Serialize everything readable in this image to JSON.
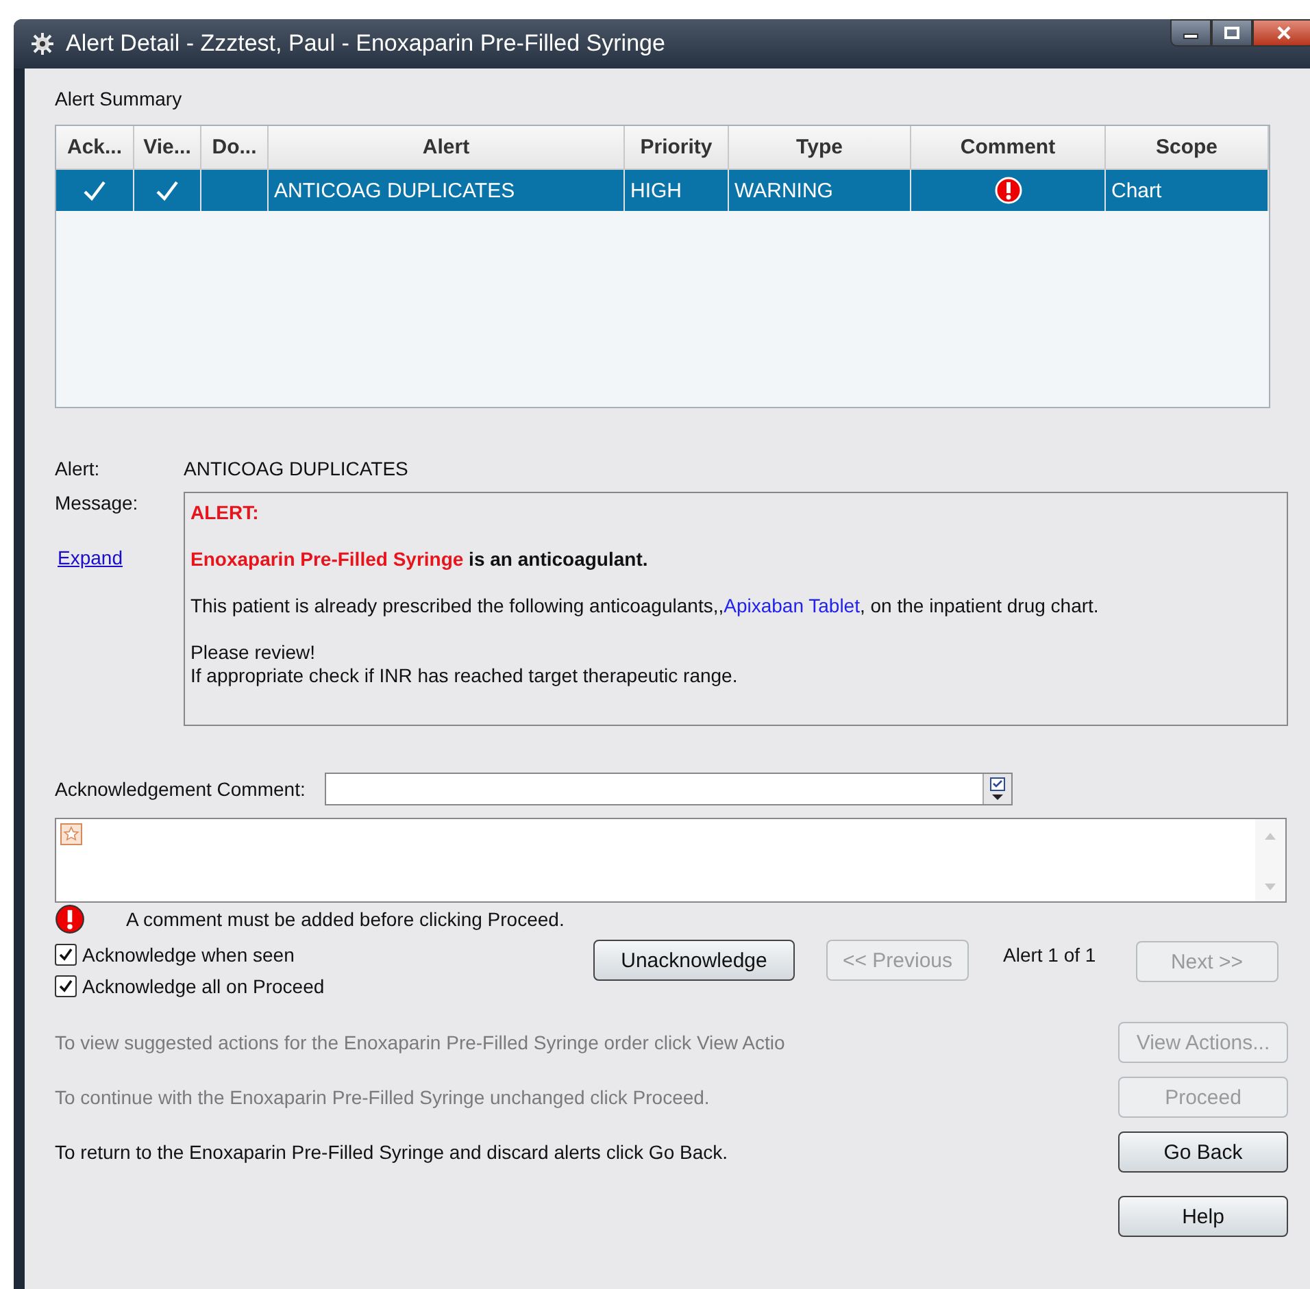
{
  "window": {
    "title": "Alert Detail - Zzztest, Paul - Enoxaparin Pre-Filled Syringe"
  },
  "summary": {
    "label": "Alert Summary",
    "columns": [
      {
        "label": "Ack...",
        "kind": "check"
      },
      {
        "label": "Vie...",
        "kind": "check"
      },
      {
        "label": "Do...",
        "kind": "check"
      },
      {
        "label": "Alert",
        "kind": "text"
      },
      {
        "label": "Priority",
        "kind": "text"
      },
      {
        "label": "Type",
        "kind": "text"
      },
      {
        "label": "Comment",
        "kind": "flag"
      },
      {
        "label": "Scope",
        "kind": "text"
      }
    ],
    "rows": [
      {
        "selected": true,
        "cells": [
          {
            "checked": true
          },
          {
            "checked": true
          },
          {
            "checked": false
          },
          {
            "text": "ANTICOAG DUPLICATES"
          },
          {
            "text": "HIGH"
          },
          {
            "text": "WARNING"
          },
          {
            "required": true
          },
          {
            "text": "Chart"
          }
        ]
      }
    ]
  },
  "alert": {
    "label": "Alert:",
    "value": "ANTICOAG DUPLICATES"
  },
  "message": {
    "label": "Message:",
    "expand": "Expand",
    "paragraphs": [
      {
        "lines": [
          [
            {
              "text": "ALERT:",
              "kind": "alert"
            }
          ]
        ]
      },
      {
        "lines": [
          [
            {
              "text": "Enoxaparin Pre-Filled Syringe",
              "kind": "alert"
            },
            {
              "text": " is an anticoagulant.",
              "kind": "bold"
            }
          ]
        ]
      },
      {
        "lines": [
          [
            {
              "text": "This patient is already prescribed the following anticoagulants,,",
              "kind": "plain"
            },
            {
              "text": "Apixaban Tablet",
              "kind": "drug"
            },
            {
              "text": ", on the inpatient drug chart.",
              "kind": "plain"
            }
          ]
        ]
      },
      {
        "lines": [
          [
            {
              "text": "Please review!",
              "kind": "plain"
            }
          ],
          [
            {
              "text": "If appropriate check if INR has reached target therapeutic range.",
              "kind": "plain"
            }
          ]
        ]
      }
    ]
  },
  "comment": {
    "label": "Acknowledgement Comment:",
    "warning": "A comment must be added before clicking Proceed.",
    "required": true
  },
  "options": [
    {
      "label": "Acknowledge when seen",
      "checked": true
    },
    {
      "label": "Acknowledge all on Proceed",
      "checked": true
    }
  ],
  "navigation": {
    "unacknowledge": {
      "label": "Unacknowledge",
      "disabled": false
    },
    "previous": {
      "label": "<< Previous",
      "disabled": true
    },
    "position": "Alert 1 of 1",
    "next": {
      "label": "Next >>",
      "disabled": true
    }
  },
  "actions": [
    {
      "text": "To view suggested actions for the Enoxaparin Pre-Filled Syringe order click View Actio",
      "button": "View Actions...",
      "disabled": true
    },
    {
      "text": "To continue with the Enoxaparin Pre-Filled Syringe unchanged click Proceed.",
      "button": "Proceed",
      "disabled": true
    },
    {
      "text": "To return to the Enoxaparin Pre-Filled Syringe and discard alerts click Go Back.",
      "button": "Go Back",
      "disabled": false
    }
  ],
  "help": {
    "label": "Help"
  }
}
